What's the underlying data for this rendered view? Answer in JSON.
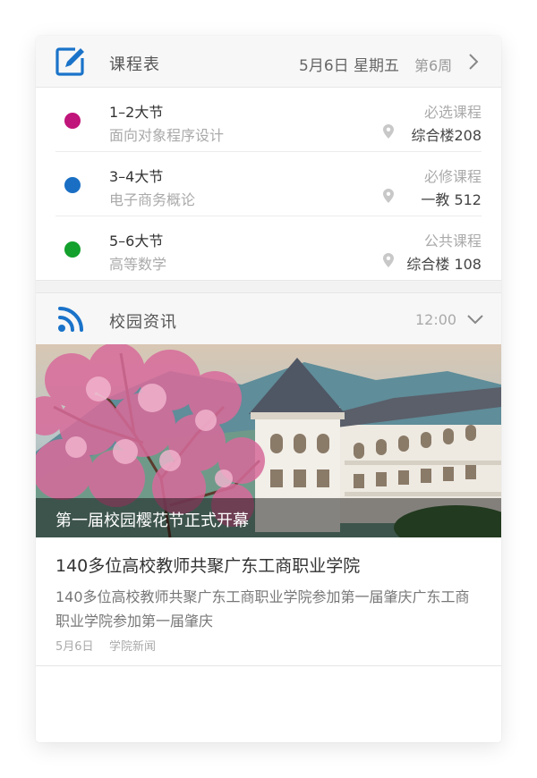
{
  "schedule": {
    "title": "课程表",
    "date": "5月6日 星期五",
    "week": "第6周",
    "icon": "edit-icon",
    "courses": [
      {
        "period": "1–2大节",
        "name": "面向对象程序设计",
        "type": "必选课程",
        "location": "综合楼208",
        "color": "#c0157a"
      },
      {
        "period": "3–4大节",
        "name": "电子商务概论",
        "type": "必修课程",
        "location": "一教 512",
        "color": "#1a6fc4"
      },
      {
        "period": "5–6大节",
        "name": "高等数学",
        "type": "公共课程",
        "location": "综合楼 108",
        "color": "#13a02c"
      }
    ]
  },
  "news": {
    "title": "校园资讯",
    "time": "12:00",
    "icon": "rss-icon",
    "banner_caption": "第一届校园樱花节正式开幕",
    "article": {
      "title": "140多位高校教师共聚广东工商职业学院",
      "summary": "140多位高校教师共聚广东工商职业学院参加第一届肇庆广东工商职业学院参加第一届肇庆",
      "date": "5月6日",
      "source": "学院新闻"
    }
  },
  "colors": {
    "accent": "#1a73c9",
    "header_bg": "#f7f7f7"
  }
}
